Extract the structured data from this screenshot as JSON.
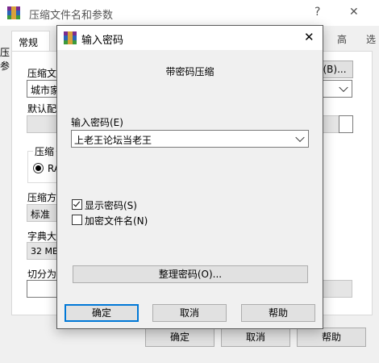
{
  "parent": {
    "title": "压缩文件名和参数",
    "help_btn": "?",
    "close_btn": "✕",
    "tabs": [
      "常规",
      "高",
      "选"
    ],
    "edge_labels": [
      "压",
      "参"
    ],
    "archive_name_label": "压缩文",
    "archive_name_value": "城市家",
    "browse_button": "(B)...",
    "default_profile_label": "默认配",
    "format_label": "压缩",
    "format_option": "RA",
    "method_label": "压缩方",
    "method_value": "标准",
    "dict_label": "字典大",
    "dict_value": "32 MB",
    "split_label": "切分为",
    "ok": "确定",
    "cancel": "取消",
    "help": "帮助"
  },
  "dialog": {
    "title": "输入密码",
    "close_btn": "✕",
    "subtitle": "带密码压缩",
    "password_label": "输入密码(E)",
    "password_value": "上老王论坛当老王",
    "show_password_label": "显示密码(S)",
    "show_password_checked": true,
    "encrypt_names_label": "加密文件名(N)",
    "encrypt_names_checked": false,
    "organize_button": "整理密码(O)...",
    "ok": "确定",
    "cancel": "取消",
    "help": "帮助"
  },
  "colors": {
    "accent": "#0078d7",
    "window_bg": "#f0f0f0",
    "button_bg": "#e1e1e1"
  }
}
